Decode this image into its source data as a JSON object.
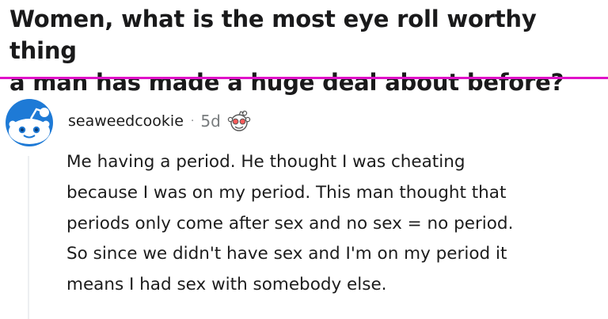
{
  "post": {
    "title": "Women, what is the most eye roll worthy thing\na man has made a huge deal about before?",
    "divider_color": "#e012c8"
  },
  "comment": {
    "avatar_icon": "reddit-snoo-avatar-icon",
    "username": "seaweedcookie",
    "separator": "·",
    "age": "5d",
    "award_icon": "wholesome-award-icon",
    "body": "Me having a period. He thought I was cheating\nbecause I was on my period. This man thought that\nperiods only come after sex and no sex = no period.\nSo since we didn't have sex and I'm on my period it\nmeans I had sex with somebody else."
  }
}
